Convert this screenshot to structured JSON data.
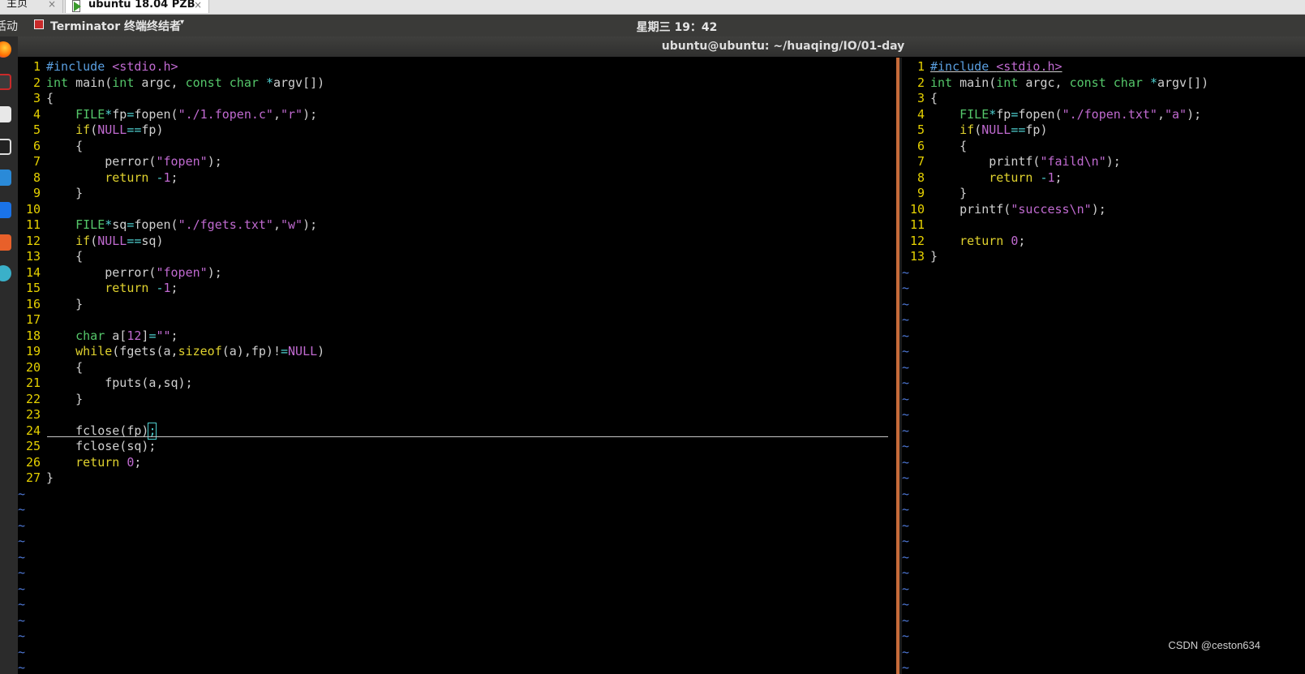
{
  "browser_tabs": [
    {
      "label": "主页",
      "close": "×"
    },
    {
      "label": "ubuntu 18.04 PZB",
      "close": "×"
    }
  ],
  "top_panel": {
    "activities": "活动",
    "app_name": "Terminator 终端终结者",
    "app_caret": "▾",
    "clock": "星期三 19：42"
  },
  "window_title": "ubuntu@ubuntu: ~/huaqing/IO/01-day",
  "left_pane": {
    "lines": [
      {
        "n": "1",
        "code": "#include <stdio.h>"
      },
      {
        "n": "2",
        "code": "int main(int argc, const char *argv[])"
      },
      {
        "n": "3",
        "code": "{"
      },
      {
        "n": "4",
        "code": "    FILE*fp=fopen(\"./1.fopen.c\",\"r\");"
      },
      {
        "n": "5",
        "code": "    if(NULL==fp)"
      },
      {
        "n": "6",
        "code": "    {"
      },
      {
        "n": "7",
        "code": "        perror(\"fopen\");"
      },
      {
        "n": "8",
        "code": "        return -1;"
      },
      {
        "n": "9",
        "code": "    }"
      },
      {
        "n": "10",
        "code": ""
      },
      {
        "n": "11",
        "code": "    FILE*sq=fopen(\"./fgets.txt\",\"w\");"
      },
      {
        "n": "12",
        "code": "    if(NULL==sq)"
      },
      {
        "n": "13",
        "code": "    {"
      },
      {
        "n": "14",
        "code": "        perror(\"fopen\");"
      },
      {
        "n": "15",
        "code": "        return -1;"
      },
      {
        "n": "16",
        "code": "    }"
      },
      {
        "n": "17",
        "code": ""
      },
      {
        "n": "18",
        "code": "    char a[12]=\"\";"
      },
      {
        "n": "19",
        "code": "    while(fgets(a,sizeof(a),fp)!=NULL)"
      },
      {
        "n": "20",
        "code": "    {"
      },
      {
        "n": "21",
        "code": "        fputs(a,sq);"
      },
      {
        "n": "22",
        "code": "    }"
      },
      {
        "n": "23",
        "code": ""
      },
      {
        "n": "24",
        "code": "    fclose(fp);"
      },
      {
        "n": "25",
        "code": "    fclose(sq);"
      },
      {
        "n": "26",
        "code": "    return 0;"
      },
      {
        "n": "27",
        "code": "}"
      }
    ],
    "cursor_line": "24",
    "tilde": "~"
  },
  "right_pane": {
    "lines": [
      {
        "n": "1",
        "code": "#include <stdio.h>"
      },
      {
        "n": "2",
        "code": "int main(int argc, const char *argv[])"
      },
      {
        "n": "3",
        "code": "{"
      },
      {
        "n": "4",
        "code": "    FILE*fp=fopen(\"./fopen.txt\",\"a\");"
      },
      {
        "n": "5",
        "code": "    if(NULL==fp)"
      },
      {
        "n": "6",
        "code": "    {"
      },
      {
        "n": "7",
        "code": "        printf(\"faild\\n\");"
      },
      {
        "n": "8",
        "code": "        return -1;"
      },
      {
        "n": "9",
        "code": "    }"
      },
      {
        "n": "10",
        "code": "    printf(\"success\\n\");"
      },
      {
        "n": "11",
        "code": ""
      },
      {
        "n": "12",
        "code": "    return 0;"
      },
      {
        "n": "13",
        "code": "}"
      }
    ],
    "tilde": "~"
  },
  "watermark": "CSDN @ceston634",
  "colors": {
    "line_number": "#e6d100",
    "tilde": "#4e78d6",
    "preprocessor": "#5a9fe0",
    "string": "#c06ad0",
    "keyword": "#e0d22e",
    "type": "#55c76a",
    "split_border": "#c66b3a"
  }
}
